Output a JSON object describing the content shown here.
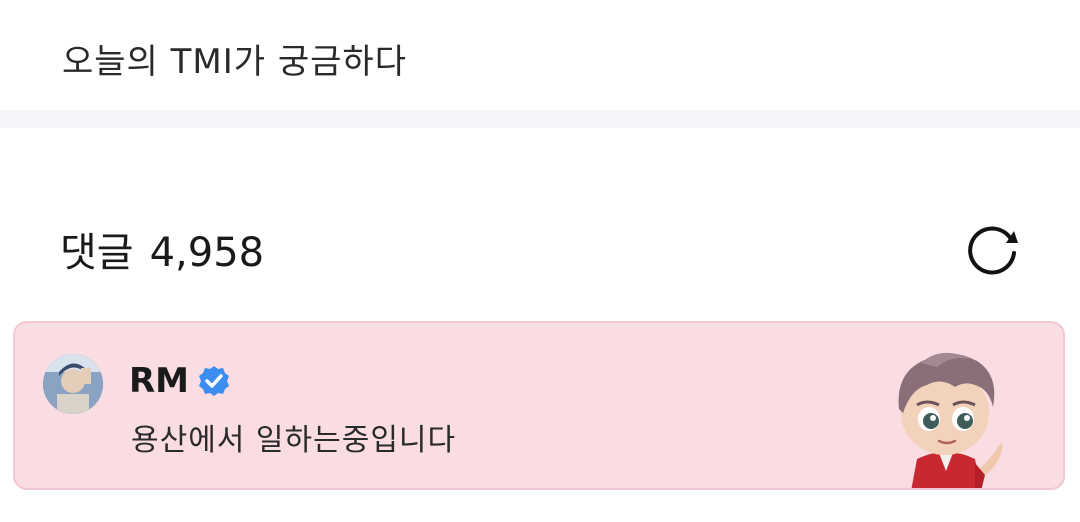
{
  "question": {
    "text": "오늘의 TMI가 궁금하다"
  },
  "comments": {
    "label": "댓글",
    "count": "4,958",
    "refresh_icon": "refresh-icon"
  },
  "pinned_comment": {
    "author": "RM",
    "verified_icon": "verified-badge-icon",
    "text": "용산에서 일하는중입니다",
    "sticker": "tinytan-rm-sticker",
    "card_color": "#fadce3"
  }
}
